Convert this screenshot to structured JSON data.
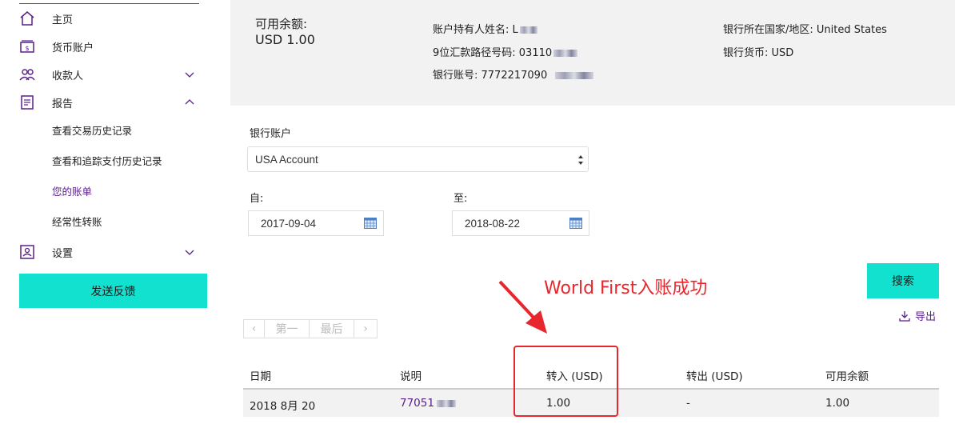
{
  "sidebar": {
    "items": [
      {
        "label": "主页",
        "icon": "home-icon"
      },
      {
        "label": "货币账户",
        "icon": "currency-account-icon"
      },
      {
        "label": "收款人",
        "icon": "recipients-icon"
      },
      {
        "label": "报告",
        "icon": "report-icon"
      },
      {
        "label": "设置",
        "icon": "settings-icon"
      }
    ],
    "report_subitems": [
      {
        "label": "查看交易历史记录"
      },
      {
        "label": "查看和追踪支付历史记录"
      },
      {
        "label": "您的账单"
      },
      {
        "label": "经常性转账"
      }
    ],
    "feedback_label": "发送反馈"
  },
  "summary": {
    "balance_label": "可用余额:",
    "balance_value": "USD 1.00",
    "holder_label": "账户持有人姓名: L",
    "routing_label": "9位汇款路径号码: 03110",
    "account_no_label": "银行账号: 7772217090",
    "country_label": "银行所在国家/地区: United States",
    "currency_label": "银行货币: USD"
  },
  "form": {
    "bank_account_label": "银行账户",
    "bank_account_value": "USA Account",
    "from_label": "自:",
    "from_value": "2017-09-04",
    "to_label": "至:",
    "to_value": "2018-08-22",
    "search_label": "搜索",
    "export_label": "导出"
  },
  "annotation": "World First入账成功",
  "pager": {
    "prev": "‹",
    "first": "第一",
    "last": "最后",
    "next": "›"
  },
  "table": {
    "headers": [
      "日期",
      "说明",
      "转入 (USD)",
      "转出 (USD)",
      "可用余额"
    ],
    "rows": [
      {
        "date": "2018 8月 20",
        "desc": "77051",
        "in": "1.00",
        "out": "-",
        "balance": "1.00"
      }
    ]
  },
  "colors": {
    "accent": "#12e1cf",
    "purple": "#5a1e8c",
    "annotation_red": "#e8262e"
  }
}
